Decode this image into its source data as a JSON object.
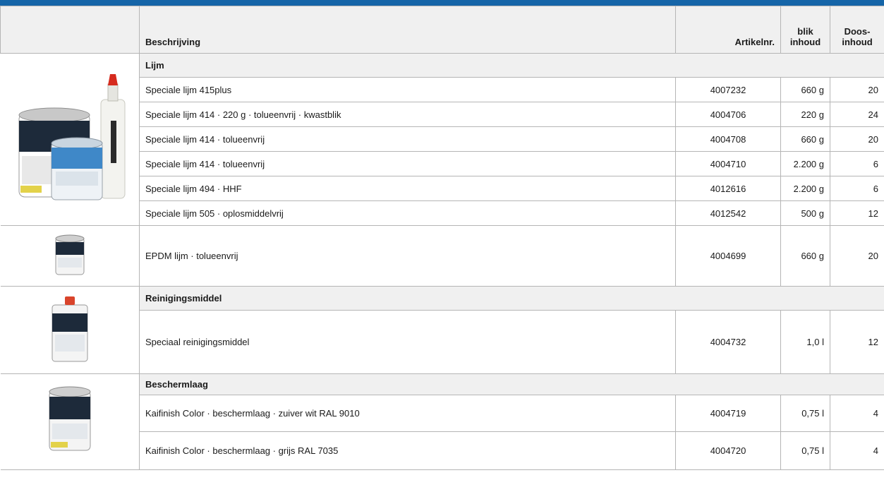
{
  "header": {
    "beschrijving": "Beschrijving",
    "artikelnr": "Artikelnr.",
    "blik_line1": "blik",
    "blik_line2": "inhoud",
    "doos_line1": "Doos-",
    "doos_line2": "inhoud"
  },
  "groups": {
    "lijm": "Lijm",
    "reiniging": "Reinigingsmiddel",
    "bescherm": "Beschermlaag"
  },
  "rows": [
    {
      "desc": "Speciale lijm 415plus",
      "art": "4007232",
      "blik": "660 g",
      "doos": "20"
    },
    {
      "desc": "Speciale lijm 414 · 220 g · tolueenvrij · kwastblik",
      "art": "4004706",
      "blik": "220 g",
      "doos": "24"
    },
    {
      "desc": "Speciale lijm 414 · tolueenvrij",
      "art": "4004708",
      "blik": "660 g",
      "doos": "20"
    },
    {
      "desc": "Speciale lijm 414 · tolueenvrij",
      "art": "4004710",
      "blik": "2.200 g",
      "doos": "6"
    },
    {
      "desc": "Speciale lijm 494 · HHF",
      "art": "4012616",
      "blik": "2.200 g",
      "doos": "6"
    },
    {
      "desc": "Speciale lijm 505 · oplosmiddelvrij",
      "art": "4012542",
      "blik": "500 g",
      "doos": "12"
    },
    {
      "desc": "EPDM lijm · tolueenvrij",
      "art": "4004699",
      "blik": "660 g",
      "doos": "20"
    },
    {
      "desc": "Speciaal reinigingsmiddel",
      "art": "4004732",
      "blik": "1,0 l",
      "doos": "12"
    },
    {
      "desc": "Kaifinish Color · beschermlaag · zuiver wit RAL 9010",
      "art": "4004719",
      "blik": "0,75 l",
      "doos": "4"
    },
    {
      "desc": "Kaifinish Color · beschermlaag · grijs RAL 7035",
      "art": "4004720",
      "blik": "0,75 l",
      "doos": "4"
    }
  ],
  "images": {
    "lijm": "glue-cans-and-bottle",
    "epdm": "epdm-glue-can",
    "reiniging": "cleaner-can",
    "bescherm": "coating-can"
  },
  "colors": {
    "topbar": "#1565a8",
    "header_bg": "#f0f0f0",
    "border": "#b5b5b5"
  }
}
